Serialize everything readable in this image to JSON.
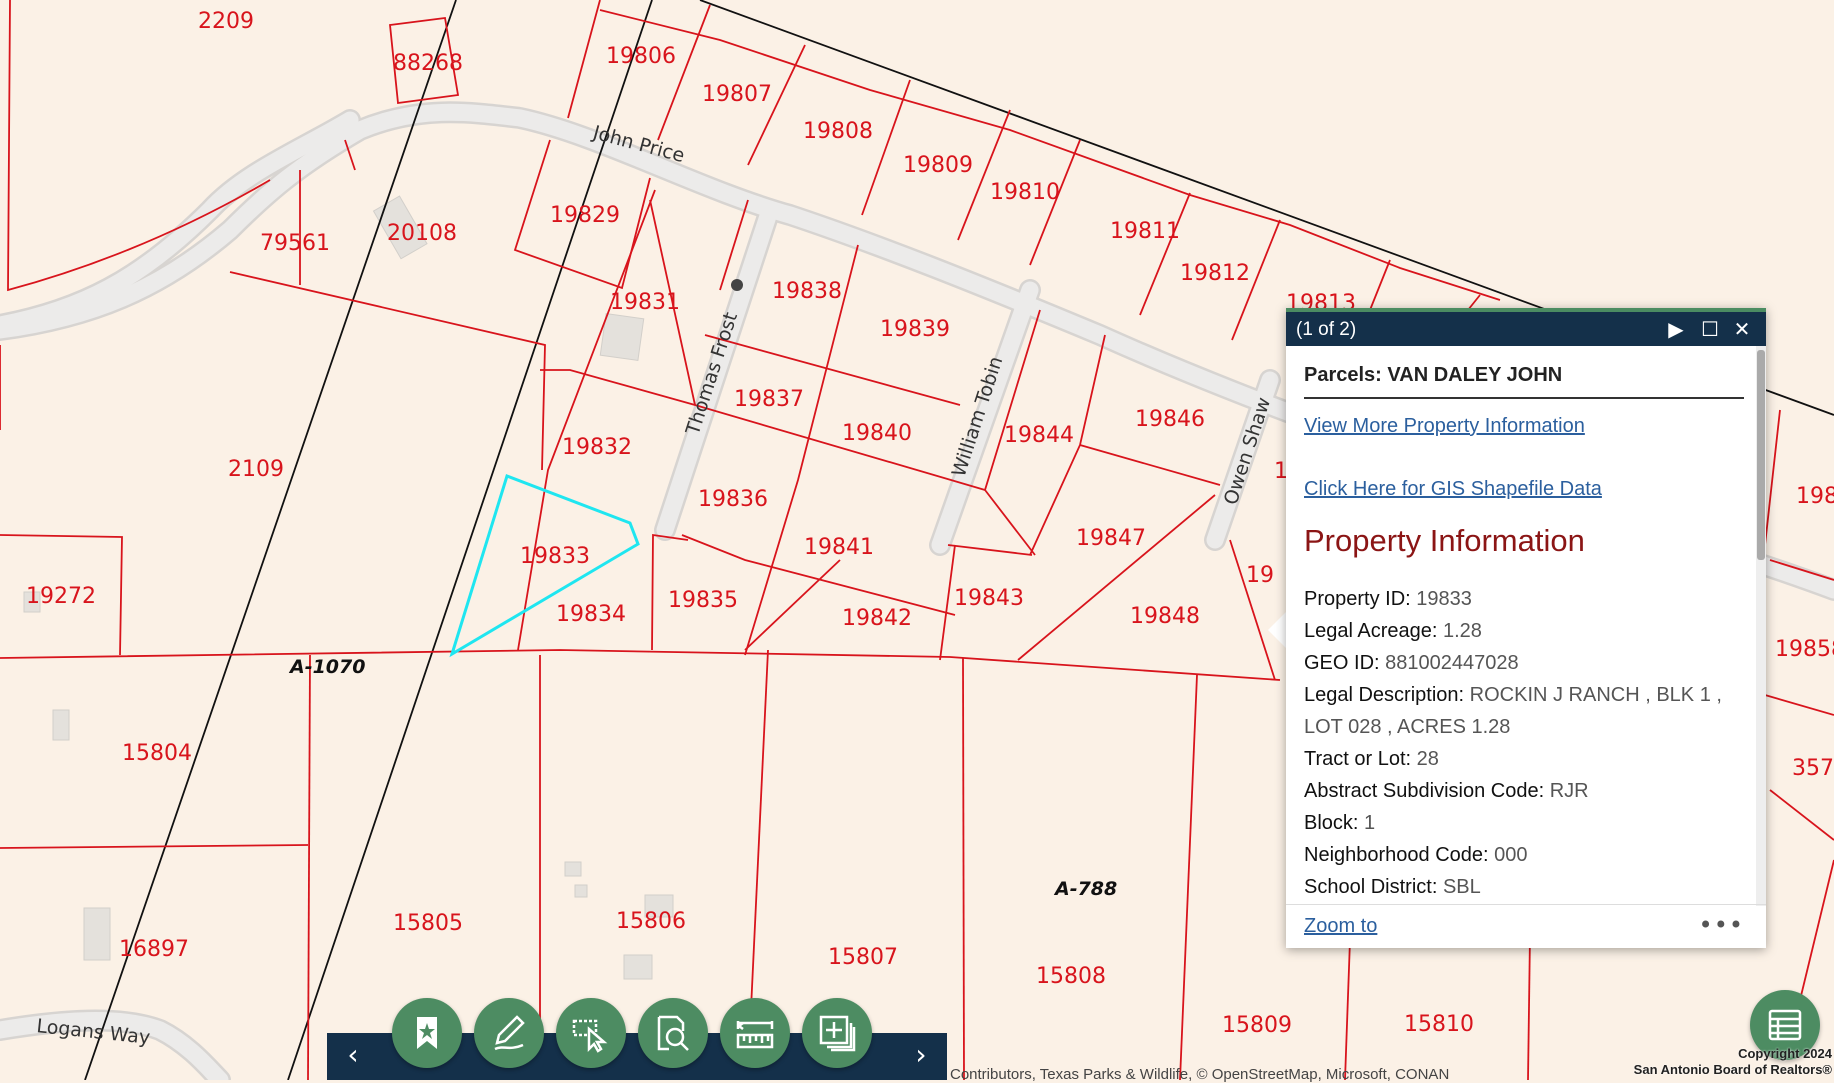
{
  "map": {
    "parcels": [
      {
        "id": "2209",
        "label": "2209"
      },
      {
        "id": "88268",
        "label": "88268"
      },
      {
        "id": "19806",
        "label": "19806"
      },
      {
        "id": "19807",
        "label": "19807"
      },
      {
        "id": "19808",
        "label": "19808"
      },
      {
        "id": "19809",
        "label": "19809"
      },
      {
        "id": "19810",
        "label": "19810"
      },
      {
        "id": "19811",
        "label": "19811"
      },
      {
        "id": "19812",
        "label": "19812"
      },
      {
        "id": "19813",
        "label": "19813"
      },
      {
        "id": "79561",
        "label": "79561"
      },
      {
        "id": "20108",
        "label": "20108"
      },
      {
        "id": "19829",
        "label": "19829"
      },
      {
        "id": "19831",
        "label": "19831"
      },
      {
        "id": "19838",
        "label": "19838"
      },
      {
        "id": "19839",
        "label": "19839"
      },
      {
        "id": "19837",
        "label": "19837"
      },
      {
        "id": "19840",
        "label": "19840"
      },
      {
        "id": "19844",
        "label": "19844"
      },
      {
        "id": "19846",
        "label": "19846"
      },
      {
        "id": "19832",
        "label": "19832"
      },
      {
        "id": "2109",
        "label": "2109"
      },
      {
        "id": "19836",
        "label": "19836"
      },
      {
        "id": "19833",
        "label": "19833"
      },
      {
        "id": "19841",
        "label": "19841"
      },
      {
        "id": "19847",
        "label": "19847"
      },
      {
        "id": "19834",
        "label": "19834"
      },
      {
        "id": "19835",
        "label": "19835"
      },
      {
        "id": "19842",
        "label": "19842"
      },
      {
        "id": "19843",
        "label": "19843"
      },
      {
        "id": "19848",
        "label": "19848"
      },
      {
        "id": "19272",
        "label": "19272"
      },
      {
        "id": "15804",
        "label": "15804"
      },
      {
        "id": "15805",
        "label": "15805"
      },
      {
        "id": "15806",
        "label": "15806"
      },
      {
        "id": "15807",
        "label": "15807"
      },
      {
        "id": "15808",
        "label": "15808"
      },
      {
        "id": "15809",
        "label": "15809"
      },
      {
        "id": "15810",
        "label": "15810"
      },
      {
        "id": "16897",
        "label": "16897"
      },
      {
        "id": "p198",
        "label": "198"
      },
      {
        "id": "p19858",
        "label": "19858"
      },
      {
        "id": "p357",
        "label": "357"
      },
      {
        "id": "p19",
        "label": "19"
      },
      {
        "id": "p1",
        "label": "1"
      }
    ],
    "streets": [
      {
        "id": "john-price",
        "label": "John Price"
      },
      {
        "id": "thomas-frost",
        "label": "Thomas Frost"
      },
      {
        "id": "william-tobin",
        "label": "William Tobin"
      },
      {
        "id": "owen-shaw",
        "label": "Owen Shaw"
      },
      {
        "id": "logans-way",
        "label": "Logans Way"
      }
    ],
    "abstracts": [
      {
        "id": "a1070",
        "label": "A-1070"
      },
      {
        "id": "a788",
        "label": "A-788"
      }
    ],
    "colors": {
      "parcel_line": "#d8141c",
      "selected": "#1fe6f0",
      "background": "#fbf1e6",
      "road": "#e6e4e2"
    }
  },
  "popup": {
    "count": "(1 of 2)",
    "title": "Parcels: VAN DALEY JOHN",
    "link_more": "View More Property Information",
    "link_gis": "Click Here for GIS Shapefile Data",
    "section": "Property Information",
    "fields": [
      {
        "key": "Property ID:",
        "value": "19833"
      },
      {
        "key": "Legal Acreage:",
        "value": "1.28"
      },
      {
        "key": "GEO ID:",
        "value": "881002447028"
      },
      {
        "key": "Legal Description:",
        "value": "ROCKIN J RANCH , BLK 1 , LOT 028 , ACRES 1.28"
      },
      {
        "key": "Tract or Lot:",
        "value": "28"
      },
      {
        "key": "Abstract Subdivision Code:",
        "value": "RJR"
      },
      {
        "key": "Block:",
        "value": "1"
      },
      {
        "key": "Neighborhood Code:",
        "value": "000"
      },
      {
        "key": "School District:",
        "value": "SBL"
      }
    ],
    "zoom": "Zoom to",
    "more": "•••",
    "icons": {
      "next": "play-icon",
      "maximize": "maximize-icon",
      "close": "close-icon"
    },
    "header_glyphs": {
      "next": "▶",
      "maximize": "☐",
      "close": "✕"
    },
    "header_color": "#14304a"
  },
  "toolbar": {
    "prev": "‹",
    "next": "›",
    "tools": [
      {
        "name": "bookmark-tool-button",
        "icon": "bookmark-icon"
      },
      {
        "name": "draw-tool-button",
        "icon": "pencil-icon"
      },
      {
        "name": "select-tool-button",
        "icon": "select-cursor-icon"
      },
      {
        "name": "search-tool-button",
        "icon": "search-document-icon"
      },
      {
        "name": "measure-tool-button",
        "icon": "ruler-icon"
      },
      {
        "name": "add-data-button",
        "icon": "add-layer-icon"
      }
    ],
    "button_color": "#4d8c62"
  },
  "attribution": "Contributors, Texas Parks & Wildlife, © OpenStreetMap, Microsoft, CONAN",
  "copyright": {
    "line1": "Copyright 2024",
    "line2": "San Antonio Board of Realtors®"
  }
}
